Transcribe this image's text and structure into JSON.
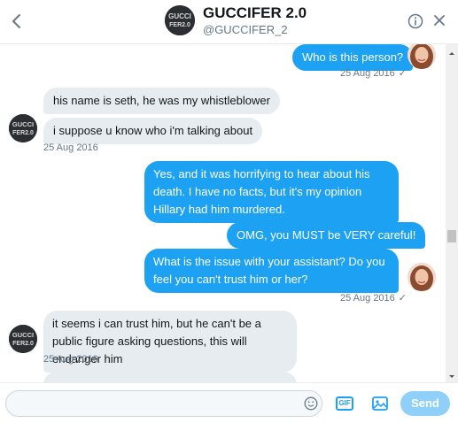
{
  "header": {
    "title": "GUCCIFER 2.0",
    "handle": "@GUCCIFER_2",
    "avatar_text_line1": "GUCCI",
    "avatar_text_line2": "FER2.0"
  },
  "messages": [
    {
      "side": "sent",
      "text": "Who is this person?"
    },
    {
      "side": "sent",
      "timestamp": "25 Aug 2016"
    },
    {
      "side": "received",
      "text": "his name is seth, he was my whistleblower"
    },
    {
      "side": "received",
      "text": "i suppose u know who i'm talking about"
    },
    {
      "side": "received",
      "timestamp": "25 Aug 2016"
    },
    {
      "side": "sent",
      "text": "Yes, and it was horrifying to hear about his death. I have no facts, but it's my opinion Hillary had him murdered."
    },
    {
      "side": "sent",
      "text": "OMG, you MUST be VERY careful!"
    },
    {
      "side": "sent",
      "text": "What is the issue with your assistant? Do you feel you can't trust him or her?"
    },
    {
      "side": "sent",
      "timestamp": "25 Aug 2016"
    },
    {
      "side": "received",
      "text": "it  seems i can trust him, but he can't be a public figure asking questions, this will endanger him"
    },
    {
      "side": "received",
      "timestamp": "25 Aug 2016"
    }
  ],
  "composer": {
    "placeholder": "",
    "gif_label": "GIF",
    "send_label": "Send"
  },
  "colors": {
    "accent": "#1da1f2",
    "received_bubble": "#e6ecf0",
    "send_disabled": "#8ed0f9"
  }
}
